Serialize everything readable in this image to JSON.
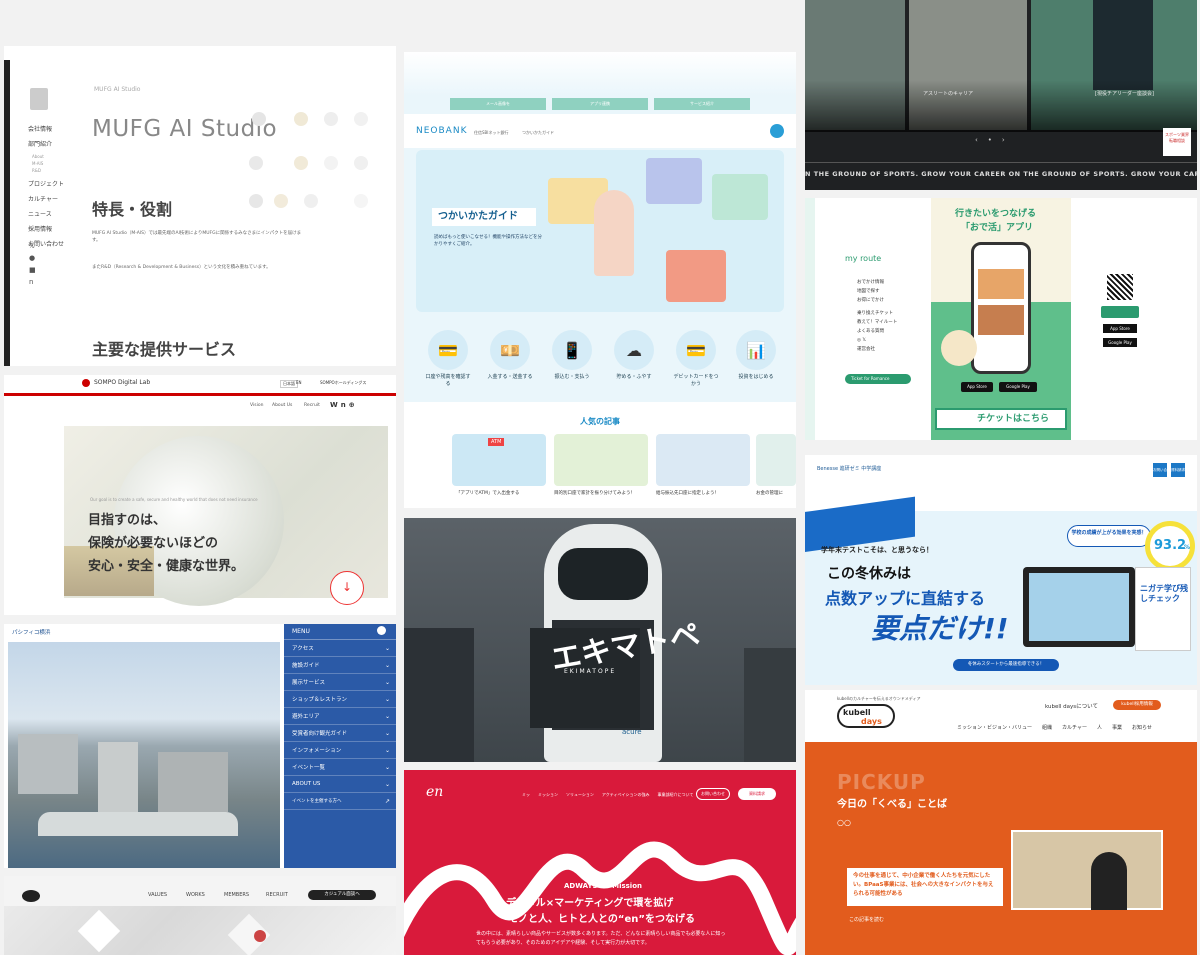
{
  "mufg": {
    "breadcrumb": "MUFG AI Studio",
    "title": "MUFG AI Studio",
    "nav": [
      "会社情報",
      "部門紹介",
      "プロジェクト",
      "カルチャー",
      "ニュース",
      "採用情報",
      "お問い合わせ"
    ],
    "subnav": [
      "About",
      "M-AIS",
      "R&D"
    ],
    "heading": "特長・役割",
    "body": "MUFG AI Studio（M-AIS）では最先端のAI技術によりMUFGに関係するみなさまにインパクトを届けます。",
    "body2": "またR&D（Research & Development & Business）という文化を積み重ねています。",
    "services": "主要な提供サービス"
  },
  "neobank": {
    "logo": "NEOBANK",
    "nav": [
      "住信SBIネット銀行",
      "つかいかたガイド"
    ],
    "tabs": [
      "メール画像を",
      "アプリ連携",
      "サービス紹介"
    ],
    "guide_title": "つかいかたガイド",
    "guide_desc": "読めばもっと使いこなせる！機能や操作方法などを分かりやすくご紹介。",
    "categories": [
      "口座や残高を確認する",
      "入金する・送金する",
      "振込む・支払う",
      "貯める・ふやす",
      "デビットカードをつかう",
      "投資をはじめる"
    ],
    "popular": "人気の記事",
    "articles": [
      "「アプリでATM」で入出金する",
      "目的別口座で家計を振り分けてみよう！",
      "給与振込先口座に指定しよう！",
      "お金の管理に"
    ],
    "atm": "ATM"
  },
  "sports": {
    "captions": [
      "[現役チアリーダー座談会]",
      "アスリートのキャリア",
      "スポーツ業界"
    ],
    "ticker": "ON THE GROUND OF SPORTS.    GROW YOUR CAREER ON THE GROUND OF SPORTS.    GROW YOUR CAREER ON THE",
    "badge": "スポーツ業界 転職相談"
  },
  "route": {
    "logo": "my route",
    "headline1": "行きたいをつなげる",
    "headline2": "「おで活」アプリ",
    "menu": [
      "おでかけ情報",
      "地図で探す",
      "お得にでかけ",
      "乗り換えチケット",
      "教えて！マイルート",
      "よくある質問",
      "運営会社"
    ],
    "ticket": "チケットはこちら",
    "appstore": "App Store",
    "googleplay": "Google Play",
    "cta": "Ticket for Romance"
  },
  "sompo": {
    "logo": "SOMPO Digital Lab",
    "brand": "SOMPOホールディングス",
    "nav": [
      "Vision",
      "About Us",
      "Recruit"
    ],
    "lang": "日本語",
    "en": "EN",
    "headline1": "目指すのは、",
    "headline2": "保険が必要ないほどの",
    "headline3": "安心・安全・健康な世界。",
    "subtext": "Our goal is to create a safe, secure and healthy world that does not need insurance"
  },
  "eki": {
    "logo": "エキマトペ",
    "romaji": "EKIMATOPE",
    "brand": "acure"
  },
  "benesse": {
    "brand": "Benesse 進研ゼミ 中学講座",
    "nav": [
      "お問い合わせ",
      "資料請求"
    ],
    "badge_text": "学校の成績が上がる効果を実感！",
    "percent": "93.2",
    "pct_sign": "%",
    "line1": "学年末テストこそは、と思うなら！",
    "line2": "この冬休みは",
    "line3": "点数アップに直結する",
    "line4": "要点だけ!!",
    "app_label": "ニガテ学び残しチェック",
    "cta": "冬休みスタートから最速指導できる！"
  },
  "pacifico": {
    "logo": "パシフィコ横浜",
    "menu_title": "MENU",
    "menu": [
      "アクセス",
      "施設ガイド",
      "展示サービス",
      "ショップ＆レストラン",
      "避外エリア",
      "受賞者向け観光ガイド",
      "インフォメーション",
      "イベント一覧",
      "ABOUT US",
      "イベントを主催する方へ"
    ]
  },
  "kubell": {
    "tagline": "kubellのカルチャーを伝えるオウンドメディア",
    "logo1": "kubell",
    "logo2": "days",
    "about": "kubell daysについて",
    "recruit": "kubell採用情報",
    "nav": [
      "ミッション・ビジョン・バリュー",
      "組織",
      "カルチャー",
      "人",
      "事業",
      "お知らせ"
    ],
    "pickup": "PICKUP",
    "today": "今日の「くべる」ことば",
    "quote": "今の仕事を通じて、中小企業で働く人たちを元気にしたい。BPaaS事業には、社会への大きなインパクトを与えられる可能性がある",
    "read": "この記事を読む"
  },
  "adways": {
    "logo": "en",
    "nav": [
      "ミッ",
      "ミッション",
      "ソリューション",
      "アクティベイションの強み",
      "事業部紹介について"
    ],
    "btn1": "お問い合わせ",
    "btn2": "資料請求",
    "mission": "ADWAYS en Mission",
    "headline1": "デジタル×マーケティングで環を拡げ",
    "headline2": "モノと人、ヒトと人との“en”をつなげる",
    "body": "世の中には、素晴らしい商品やサービスが数多くあります。ただ、どんなに素晴らしい商品でも必要な人に知ってもらう必要があり、そのためのアイデアや経験、そして実行力が大切です。"
  },
  "cube": {
    "nav": [
      "VALUES",
      "WORKS",
      "MEMBERS",
      "RECRUIT"
    ],
    "btn": "カジュアル面談へ"
  }
}
